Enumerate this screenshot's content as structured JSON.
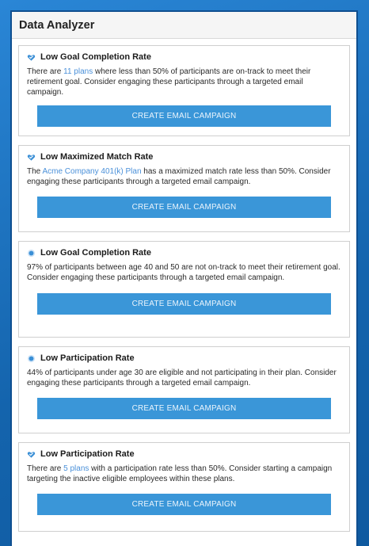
{
  "app": {
    "title": "Data Analyzer"
  },
  "cards": [
    {
      "icon": "heart-badge-icon",
      "title": "Low Goal Completion Rate",
      "body_pre": "There are ",
      "body_link": "11 plans",
      "body_post": " where less than 50% of participants are on-track to meet their retirement goal. Consider engaging these participants through a targeted email campaign.",
      "button": "CREATE EMAIL CAMPAIGN"
    },
    {
      "icon": "heart-badge-icon",
      "title": "Low Maximized Match Rate",
      "body_pre": "The ",
      "body_link": "Acme Company 401(k) Plan",
      "body_post": " has a maximized match rate less than 50%. Consider engaging these participants through a targeted email campaign.",
      "button": "CREATE EMAIL CAMPAIGN"
    },
    {
      "icon": "target-icon",
      "title": "Low Goal Completion Rate",
      "body_pre": "97% of participants between age 40 and 50 are not on-track to meet their retirement goal. Consider engaging these participants through a targeted email campaign.",
      "body_link": "",
      "body_post": "",
      "button": "CREATE EMAIL CAMPAIGN"
    },
    {
      "icon": "target-icon",
      "title": "Low Participation Rate",
      "body_pre": "44% of participants under age 30 are eligible and not participating in their plan. Consider engaging these participants through a targeted email campaign.",
      "body_link": "",
      "body_post": "",
      "button": "CREATE EMAIL CAMPAIGN"
    },
    {
      "icon": "heart-badge-icon",
      "title": "Low Participation Rate",
      "body_pre": "There are ",
      "body_link": "5 plans",
      "body_post": " with a participation rate less than 50%. Consider starting a campaign targeting the inactive eligible employees within these plans.",
      "button": "CREATE EMAIL CAMPAIGN"
    }
  ],
  "colors": {
    "accent": "#3a96d8",
    "link": "#4a90d9",
    "background": "#1d6fb8"
  }
}
